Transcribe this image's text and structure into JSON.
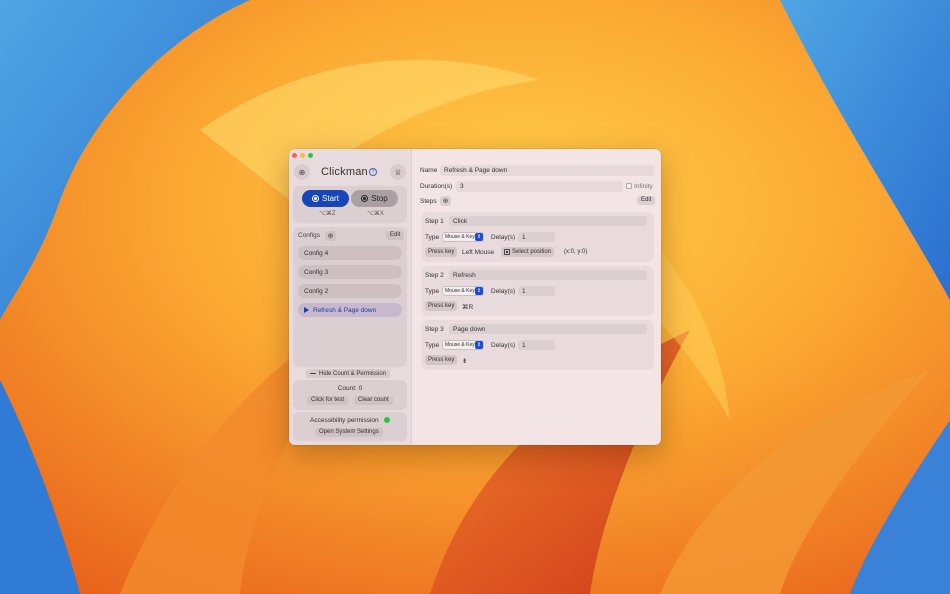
{
  "app": {
    "title": "Clickman"
  },
  "colors": {
    "accent": "#1845b8",
    "status_ok": "#2ec441"
  },
  "sidebar": {
    "start_label": "Start",
    "stop_label": "Stop",
    "start_shortcut": "⌥⌘Z",
    "stop_shortcut": "⌥⌘X",
    "configs_label": "Configs",
    "configs_edit_label": "Edit",
    "configs": [
      {
        "label": "Config 4",
        "active": false
      },
      {
        "label": "Config 3",
        "active": false
      },
      {
        "label": "Config 2",
        "active": false
      },
      {
        "label": "Refresh & Page down",
        "active": true
      }
    ],
    "hide_label": "Hide Count & Permission",
    "count_text": "Count: 0",
    "click_test_label": "Click for test",
    "clear_count_label": "Clear count",
    "accessibility_label": "Accessibility permission",
    "open_settings_label": "Open System Settings"
  },
  "main": {
    "name_label": "Name",
    "name_value": "Refresh & Page down",
    "duration_label": "Duration(s)",
    "duration_value": "3",
    "infinity_label": "Infinity",
    "steps_label": "Steps",
    "steps_edit_label": "Edit",
    "steps": [
      {
        "label": "Step 1",
        "title": "Click",
        "type_label": "Type",
        "type_value": "Mouse & Key",
        "delay_label": "Delay(s)",
        "delay_value": "1",
        "press_key_label": "Press key",
        "key_value": "Left Mouse",
        "select_position_label": "Select position",
        "position_text": "(x:0, y:0)"
      },
      {
        "label": "Step 2",
        "title": "Refresh",
        "type_label": "Type",
        "type_value": "Mouse & Key",
        "delay_label": "Delay(s)",
        "delay_value": "1",
        "press_key_label": "Press key",
        "key_value": "⌘R"
      },
      {
        "label": "Step 3",
        "title": "Page down",
        "type_label": "Type",
        "type_value": "Mouse & Key",
        "delay_label": "Delay(s)",
        "delay_value": "1",
        "press_key_label": "Press key",
        "key_value": "⇟"
      }
    ]
  }
}
